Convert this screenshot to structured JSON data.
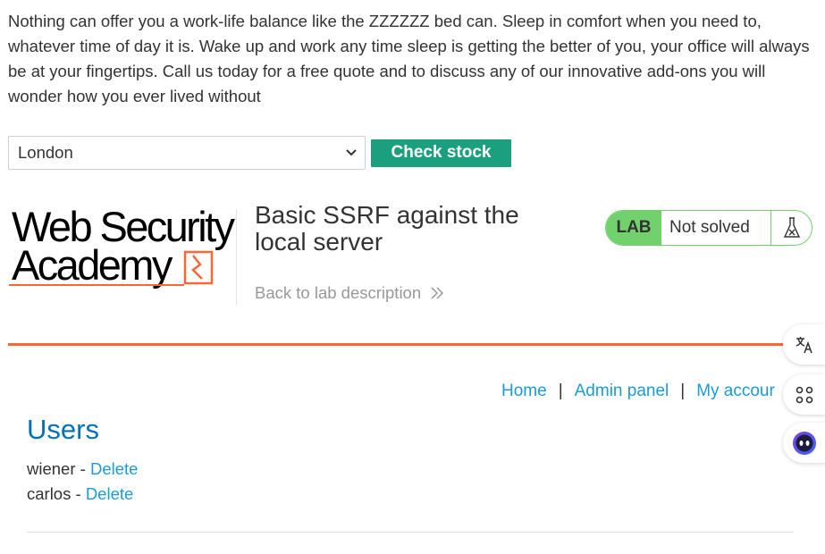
{
  "description": "Nothing can offer you a work-life balance like the ZZZZZZ bed can. Sleep in comfort when you need to, whatever time of day it is. Wake up and work any time sleep is getting the better of you, your office will always be at your fingertips. Call us today for a free quote and to discuss any of our innovative add-ons you will wonder how you ever lived without",
  "stock_check": {
    "selected_store": "London",
    "button_label": "Check stock"
  },
  "header": {
    "logo_line1": "Web Security",
    "logo_line2": "Academy",
    "lab_title": "Basic SSRF against the local server",
    "back_link": "Back to lab description",
    "lab_badge": "LAB",
    "lab_status": "Not solved",
    "flask_icon": "flask-icon"
  },
  "nav": {
    "home": "Home",
    "separator": "|",
    "admin_panel": "Admin panel",
    "my_account": "My accour"
  },
  "users": {
    "heading": "Users",
    "list": [
      {
        "name": "wiener",
        "separator": "-",
        "action": "Delete"
      },
      {
        "name": "carlos",
        "separator": "-",
        "action": "Delete"
      }
    ]
  },
  "side_tools": [
    "translate-icon",
    "command-icon",
    "assistant-face-icon"
  ],
  "colors": {
    "accent_green": "#1c9f7f",
    "lab_green": "#70d16d",
    "orange": "#ff6633",
    "link_blue": "#1b9bd9",
    "heading_blue": "#0071bc"
  }
}
